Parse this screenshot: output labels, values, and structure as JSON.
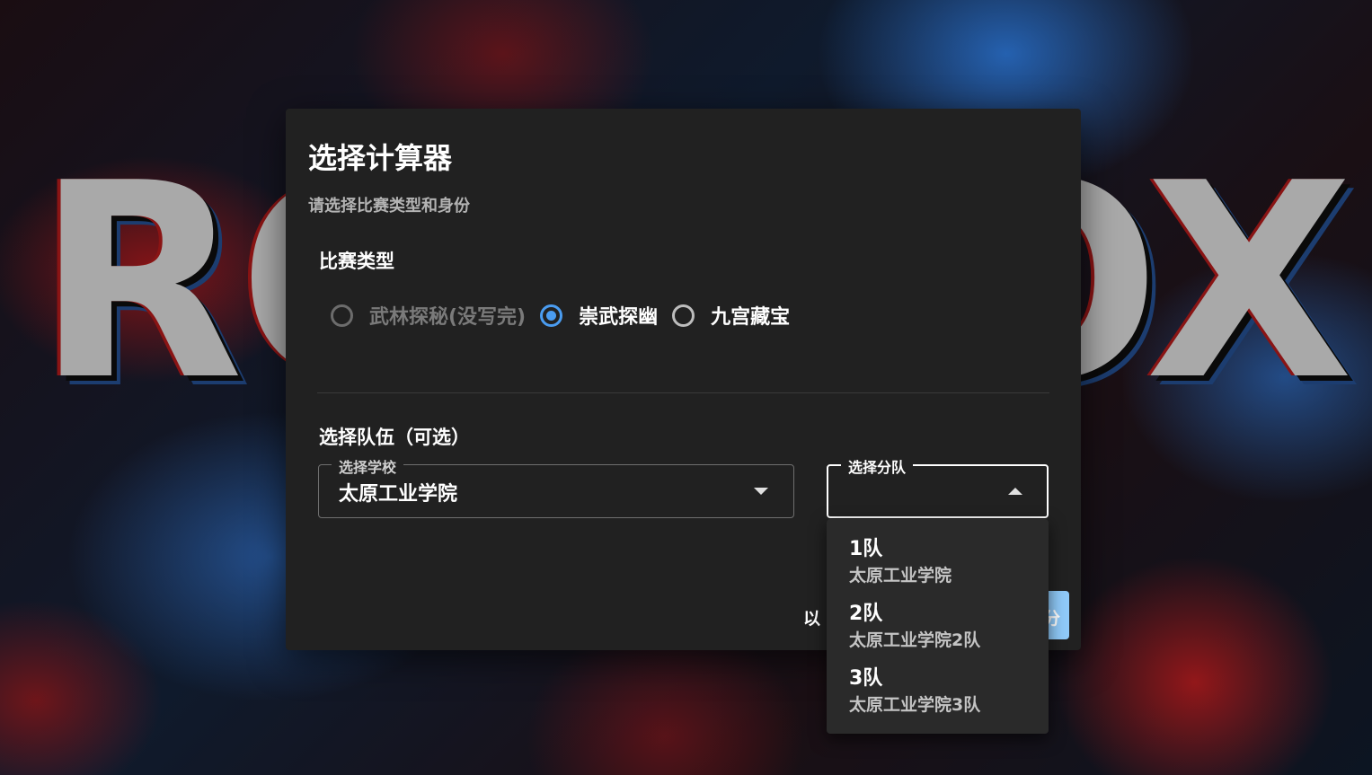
{
  "background": {
    "logo_text": [
      "RO",
      "OX"
    ]
  },
  "dialog": {
    "title": "选择计算器",
    "subtitle": "请选择比赛类型和身份",
    "contest_section": {
      "label": "比赛类型",
      "options": [
        {
          "label": "武林探秘(没写完)",
          "state": "disabled"
        },
        {
          "label": "崇武探幽",
          "state": "checked"
        },
        {
          "label": "九宫藏宝",
          "state": "unchecked"
        }
      ]
    },
    "team_section": {
      "label": "选择队伍（可选）",
      "school_select": {
        "legend": "选择学校",
        "value": "太原工业学院"
      },
      "team_select": {
        "legend": "选择分队",
        "value": ""
      }
    },
    "footer": {
      "text": "以",
      "button_label": "分"
    }
  },
  "team_menu": [
    {
      "primary": "1队",
      "secondary": "太原工业学院"
    },
    {
      "primary": "2队",
      "secondary": "太原工业学院2队"
    },
    {
      "primary": "3队",
      "secondary": "太原工业学院3队"
    }
  ],
  "colors": {
    "accent": "#4a9cf0",
    "dialog_bg": "#212121",
    "button_bg": "#90caf9"
  }
}
